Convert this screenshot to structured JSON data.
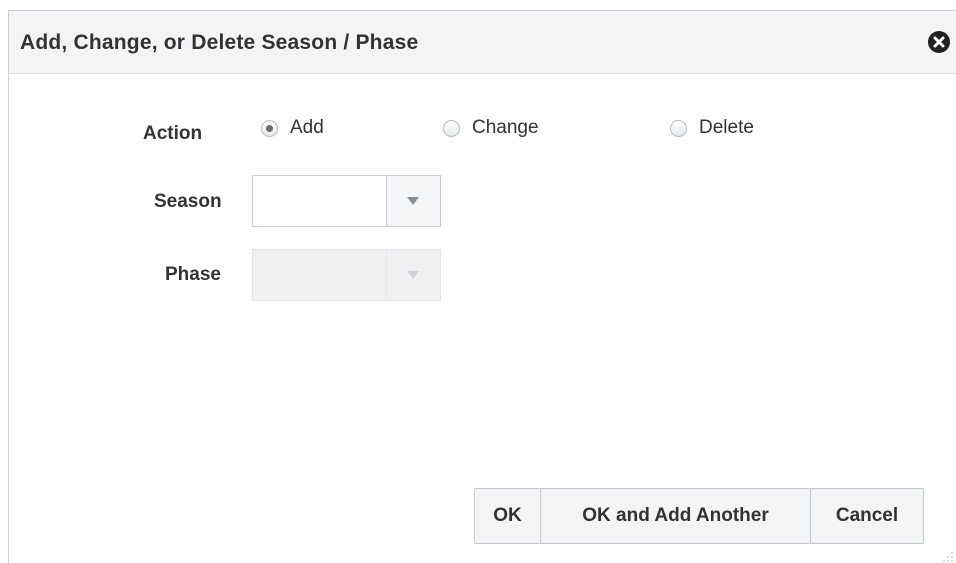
{
  "dialog": {
    "title": "Add, Change, or Delete Season / Phase",
    "close_icon": "close-icon"
  },
  "action": {
    "label": "Action",
    "options": [
      {
        "label": "Add",
        "selected": true
      },
      {
        "label": "Change",
        "selected": false
      },
      {
        "label": "Delete",
        "selected": false
      }
    ]
  },
  "season": {
    "label": "Season",
    "value": "",
    "enabled": true
  },
  "phase": {
    "label": "Phase",
    "value": "",
    "enabled": false
  },
  "buttons": {
    "ok": "OK",
    "ok_add_another": "OK and Add Another",
    "cancel": "Cancel"
  },
  "colors": {
    "header_bg": "#f2f4f5",
    "button_bg": "#f3f4f5",
    "border": "#c9cfd4",
    "text": "#333333"
  }
}
